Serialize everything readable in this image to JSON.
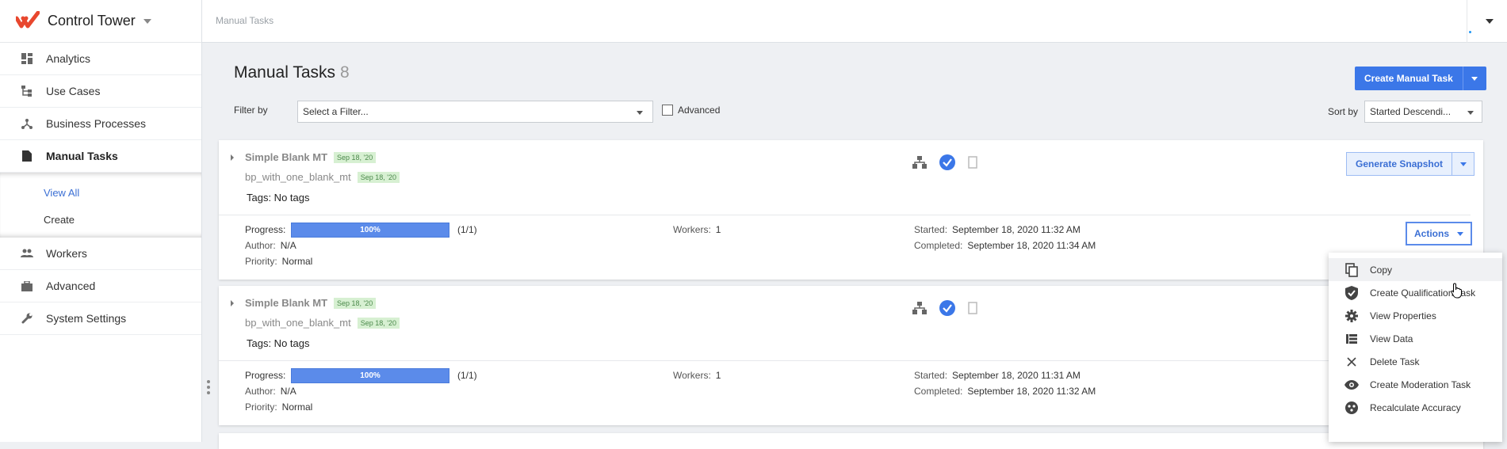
{
  "app": {
    "title": "Control Tower",
    "accent": "#3b77e8",
    "logo_color": "#e8472e"
  },
  "sidebar": {
    "items": [
      {
        "label": "Analytics",
        "icon": "dashboard-icon"
      },
      {
        "label": "Use Cases",
        "icon": "hierarchy-icon"
      },
      {
        "label": "Business Processes",
        "icon": "process-icon"
      },
      {
        "label": "Manual Tasks",
        "icon": "document-icon",
        "active": true
      },
      {
        "label": "Workers",
        "icon": "people-icon"
      },
      {
        "label": "Advanced",
        "icon": "briefcase-icon"
      },
      {
        "label": "System Settings",
        "icon": "wrench-icon"
      }
    ],
    "sub_items": [
      {
        "label": "View All",
        "active": true
      },
      {
        "label": "Create"
      }
    ]
  },
  "topbar": {
    "breadcrumb": "Manual Tasks"
  },
  "header": {
    "title": "Manual Tasks",
    "count": "8",
    "create_label": "Create Manual Task",
    "filter_label": "Filter by",
    "filter_placeholder": "Select a Filter...",
    "advanced_label": "Advanced",
    "sort_label": "Sort by",
    "sort_value": "Started Descendi..."
  },
  "labels": {
    "generate_snapshot": "Generate Snapshot",
    "actions": "Actions",
    "progress": "Progress:",
    "author": "Author:",
    "priority": "Priority:",
    "workers": "Workers:",
    "started": "Started:",
    "completed": "Completed:"
  },
  "tasks": [
    {
      "name": "Simple Blank MT",
      "name_date": "Sep 18, '20",
      "process": "bp_with_one_blank_mt",
      "process_date": "Sep 18, '20",
      "tags": "Tags: No tags",
      "progress_pct": "100%",
      "progress_fraction": 1.0,
      "progress_count": "(1/1)",
      "author": "N/A",
      "priority": "Normal",
      "workers": "1",
      "started": "September 18, 2020 11:32 AM",
      "completed": "September 18, 2020 11:34 AM"
    },
    {
      "name": "Simple Blank MT",
      "name_date": "Sep 18, '20",
      "process": "bp_with_one_blank_mt",
      "process_date": "Sep 18, '20",
      "tags": "Tags: No tags",
      "progress_pct": "100%",
      "progress_fraction": 1.0,
      "progress_count": "(1/1)",
      "author": "N/A",
      "priority": "Normal",
      "workers": "1",
      "started": "September 18, 2020 11:31 AM",
      "completed": "September 18, 2020 11:32 AM"
    }
  ],
  "menu": [
    {
      "label": "Copy",
      "icon": "copy-icon"
    },
    {
      "label": "Create Qualification Task",
      "icon": "shield-check-icon"
    },
    {
      "label": "View Properties",
      "icon": "gear-icon"
    },
    {
      "label": "View Data",
      "icon": "table-icon"
    },
    {
      "label": "Delete Task",
      "icon": "close-icon"
    },
    {
      "label": "Create Moderation Task",
      "icon": "eye-icon"
    },
    {
      "label": "Recalculate Accuracy",
      "icon": "recalculate-icon"
    }
  ]
}
